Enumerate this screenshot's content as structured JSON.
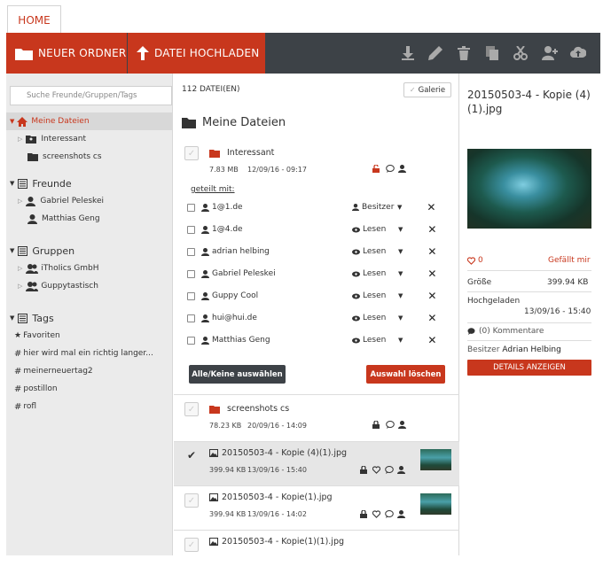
{
  "tabs": {
    "home": "HOME"
  },
  "toolbar": {
    "new_folder": "NEUER ORDNER",
    "upload": "DATEI HOCHLADEN"
  },
  "sidebar": {
    "search_placeholder": "Suche Freunde/Gruppen/Tags",
    "my_files": "Meine Dateien",
    "folders": [
      "Interessant",
      "screenshots cs"
    ],
    "friends_header": "Freunde",
    "friends": [
      "Gabriel Peleskei",
      "Matthias Geng"
    ],
    "groups_header": "Gruppen",
    "groups": [
      "iThoIics GmbH",
      "Guppytastisch"
    ],
    "tags_header": "Tags",
    "tags": [
      "Favoriten",
      "hier wird mal ein richtig langer...",
      "meinerneuertag2",
      "postillon",
      "rofl"
    ]
  },
  "middle": {
    "file_count": "112 DATEI(EN)",
    "gallery": "Galerie",
    "title": "Meine Dateien",
    "folder1": {
      "name": "Interessant",
      "size": "7.83 MB",
      "date": "12/09/16 - 09:17"
    },
    "shared_with": "geteilt mit:",
    "shares": [
      {
        "name": "1@1.de",
        "role": "Besitzer"
      },
      {
        "name": "1@4.de",
        "role": "Lesen"
      },
      {
        "name": "adrian helbing",
        "role": "Lesen"
      },
      {
        "name": "Gabriel Peleskei",
        "role": "Lesen"
      },
      {
        "name": "Guppy Cool",
        "role": "Lesen"
      },
      {
        "name": "hui@hui.de",
        "role": "Lesen"
      },
      {
        "name": "Matthias Geng",
        "role": "Lesen"
      }
    ],
    "select_all": "Alle/Keine auswählen",
    "delete_selection": "Auswahl löschen",
    "folder2": {
      "name": "screenshots cs",
      "size": "78.23 KB",
      "date": "20/09/16 - 14:09"
    },
    "files": [
      {
        "name": "20150503-4 - Kopie (4)(1).jpg",
        "size": "399.94 KB",
        "date": "13/09/16 - 15:40"
      },
      {
        "name": "20150503-4 - Kopie(1).jpg",
        "size": "399.94 KB",
        "date": "13/09/16 - 14:02"
      },
      {
        "name": "20150503-4 - Kopie(1)(1).jpg",
        "size": "",
        "date": ""
      }
    ]
  },
  "detail": {
    "title": "20150503-4 - Kopie (4)(1).jpg",
    "likes": "0",
    "like_text": "Gefällt mir",
    "size_label": "Größe",
    "size_value": "399.94 KB",
    "uploaded_label": "Hochgeladen",
    "uploaded_value": "13/09/16 - 15:40",
    "comments": "(0) Kommentare",
    "owner_label": "Besitzer",
    "owner_name": "Adrian Helbing",
    "details_button": "DETAILS ANZEIGEN"
  },
  "colors": {
    "accent": "#c8371d",
    "toolbar": "#3d4247",
    "sidebar": "#ebebeb"
  }
}
